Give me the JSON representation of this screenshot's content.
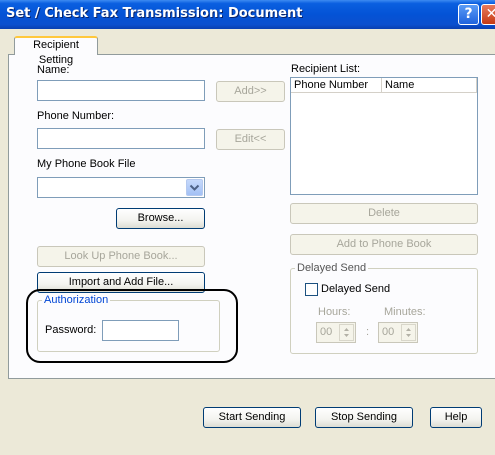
{
  "title": "Set / Check Fax Transmission: Document",
  "titlebar": {
    "help_glyph": "?",
    "close_glyph": "✕"
  },
  "tab": {
    "label": "Recipient Setting"
  },
  "fields": {
    "name_label": "Name:",
    "name_value": "",
    "phone_label": "Phone Number:",
    "phone_value": "",
    "phonebook_label": "My Phone Book File",
    "phonebook_value": ""
  },
  "buttons": {
    "add": "Add>>",
    "edit": "Edit<<",
    "browse": "Browse...",
    "lookup": "Look Up Phone Book...",
    "import": "Import and Add File...",
    "delete": "Delete",
    "add_to_phonebook": "Add to Phone Book",
    "start": "Start Sending",
    "stop": "Stop Sending",
    "help": "Help"
  },
  "recipient_list": {
    "label": "Recipient List:",
    "columns": [
      "Phone Number",
      "Name"
    ]
  },
  "delayed": {
    "group": "Delayed Send",
    "checkbox": "Delayed Send",
    "checked": false,
    "hours_label": "Hours:",
    "minutes_label": "Minutes:",
    "hours": "00",
    "minutes": "00",
    "sep": ":"
  },
  "auth": {
    "group": "Authorization",
    "password_label": "Password:",
    "password_value": ""
  },
  "icons": {
    "select_arrow": "chevron-down-icon",
    "spin": "spin-arrows-icon"
  },
  "colors": {
    "titlebar": "#0453d6",
    "group_legend": "#0046d5",
    "tab_highlight": "#ffc83c"
  }
}
